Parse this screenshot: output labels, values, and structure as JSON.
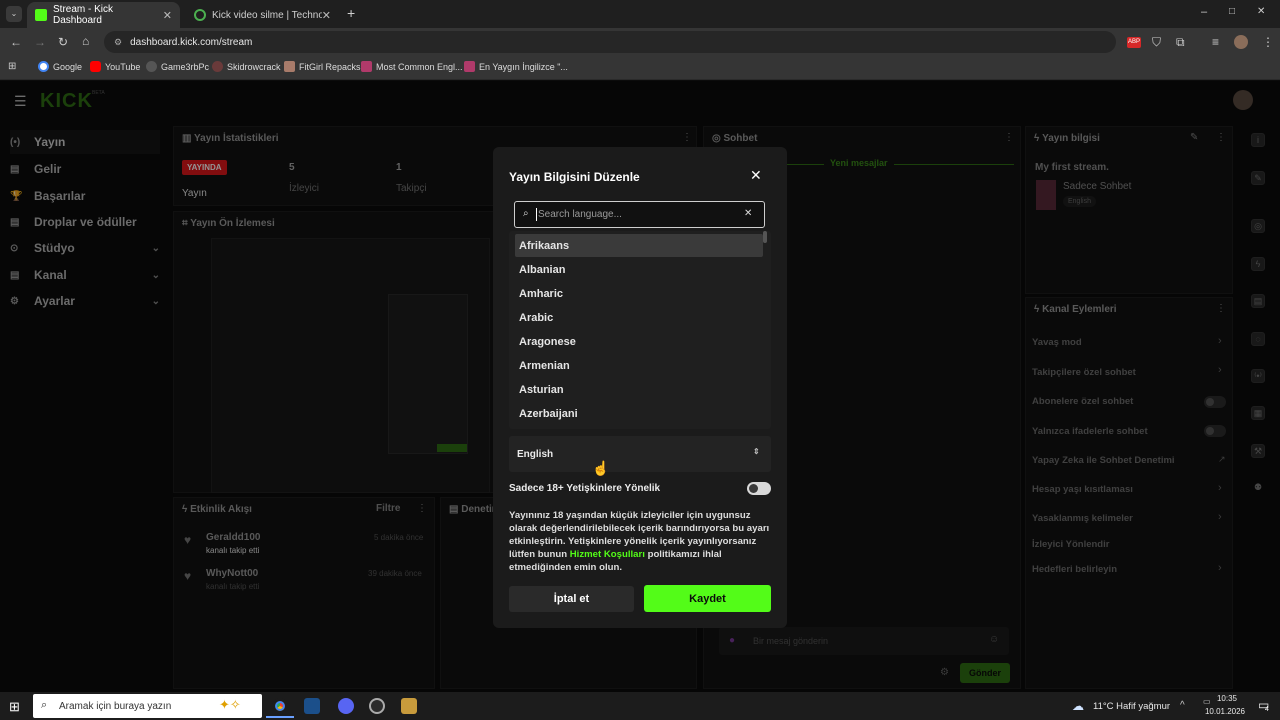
{
  "browser": {
    "tabs": [
      {
        "title": "Stream - Kick Dashboard",
        "active": true
      },
      {
        "title": "Kick video silme | Technopat So",
        "active": false
      }
    ],
    "new_tab": "+",
    "url": "dashboard.kick.com/stream",
    "bookmarks": [
      "Google",
      "YouTube",
      "Game3rbPc",
      "Skidrowcrack",
      "FitGirl Repacks",
      "Most Common Engl...",
      "En Yaygın İngilizce \"..."
    ],
    "window_controls": [
      "–",
      "□",
      "✕"
    ]
  },
  "kick": {
    "logo": "KICK",
    "beta": "BETA",
    "sidebar": [
      {
        "icon": "(•)",
        "label": "Yayın",
        "chevron": false
      },
      {
        "icon": "▤",
        "label": "Gelir",
        "chevron": false
      },
      {
        "icon": "🏆",
        "label": "Başarılar",
        "chevron": false
      },
      {
        "icon": "▤",
        "label": "Droplar ve ödüller",
        "chevron": false
      },
      {
        "icon": "⊙",
        "label": "Stüdyo",
        "chevron": true
      },
      {
        "icon": "▤",
        "label": "Kanal",
        "chevron": true
      },
      {
        "icon": "⚙",
        "label": "Ayarlar",
        "chevron": true
      }
    ],
    "stats": {
      "title": "Yayın İstatistikleri",
      "live_badge": "YAYINDA",
      "items": [
        {
          "value": "",
          "label": "Yayın"
        },
        {
          "value": "5",
          "label": "İzleyici"
        },
        {
          "value": "1",
          "label": "Takipçi"
        }
      ]
    },
    "preview": {
      "title": "Yayın Ön İzlemesi"
    },
    "activity": {
      "title": "Etkinlik Akışı",
      "filter": "Filtre",
      "items": [
        {
          "user": "Geraldd100",
          "action": "kanalı takip etti",
          "time": "5 dakika önce"
        },
        {
          "user": "WhyNott00",
          "action": "kanalı takip etti",
          "time": "39 dakika önce"
        }
      ]
    },
    "mod_panel": {
      "title": "Denetim"
    },
    "chat": {
      "title": "Sohbet",
      "new_messages": "Yeni mesajlar",
      "input_placeholder": "Bir mesaj gönderin",
      "send": "Gönder"
    },
    "stream_info": {
      "title": "Yayın bilgisi",
      "stream_title": "My first stream.",
      "category": "Sadece Sohbet",
      "language": "English"
    },
    "channel_actions": {
      "title": "Kanal Eylemleri",
      "items": [
        {
          "label": "Yavaş mod",
          "control": "chevron"
        },
        {
          "label": "Takipçilere özel sohbet",
          "control": "chevron"
        },
        {
          "label": "Abonelere özel sohbet",
          "control": "toggle"
        },
        {
          "label": "Yalnızca ifadelerle sohbet",
          "control": "toggle"
        },
        {
          "label": "Yapay Zeka ile Sohbet Denetimi",
          "control": "external"
        },
        {
          "label": "Hesap yaşı kısıtlaması",
          "control": "chevron"
        },
        {
          "label": "Yasaklanmış kelimeler",
          "control": "chevron"
        },
        {
          "label": "İzleyici Yönlendir",
          "control": "none"
        },
        {
          "label": "Hedefleri belirleyin",
          "control": "chevron"
        }
      ]
    }
  },
  "modal": {
    "title": "Yayın Bilgisini Düzenle",
    "close": "✕",
    "search_placeholder": "Search language...",
    "search_clear": "✕",
    "languages": [
      "Afrikaans",
      "Albanian",
      "Amharic",
      "Arabic",
      "Aragonese",
      "Armenian",
      "Asturian",
      "Azerbaijani"
    ],
    "highlighted_index": 0,
    "selected_language": "English",
    "adult_label": "Sadece 18+ Yetişkinlere Yönelik",
    "adult_enabled": false,
    "adult_desc_before": "Yayınınız 18 yaşından küçük izleyiciler için uygunsuz olarak değerlendirilebilecek içerik barındırıyorsa bu ayarı etkinleştirin. Yetişkinlere yönelik içerik yayınlıyorsanız lütfen bunun ",
    "adult_desc_link": "Hizmet Koşulları",
    "adult_desc_after": " politikamızı ihlal etmediğinden emin olun.",
    "cancel": "İptal et",
    "save": "Kaydet"
  },
  "taskbar": {
    "search_placeholder": "Aramak için buraya yazın",
    "weather": "11°C  Hafif yağmur",
    "time": "10:35",
    "date": "10.01.2026",
    "notifications": "4"
  },
  "colors": {
    "accent": "#53fc18",
    "live": "#e1171b",
    "modal_bg": "#1b1b1b"
  }
}
